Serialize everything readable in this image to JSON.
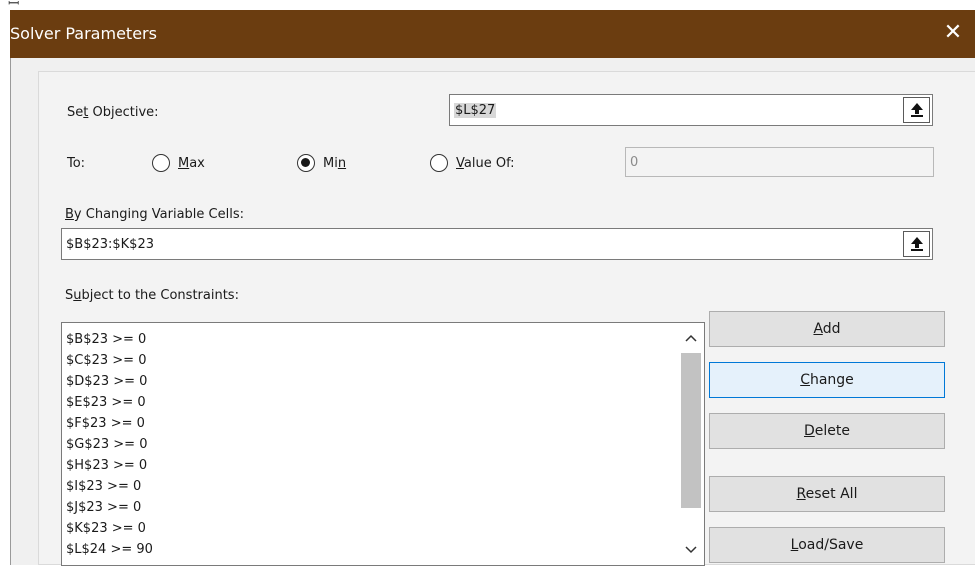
{
  "dialog": {
    "title": "Solver Parameters",
    "close_glyph": "✕"
  },
  "objective": {
    "label_pre": "Se",
    "label_u": "t",
    "label_post": " Objective:",
    "value": "$L$27"
  },
  "to": {
    "label": "To:",
    "max": {
      "pre": "",
      "u": "M",
      "post": "ax",
      "selected": false
    },
    "min": {
      "pre": "Mi",
      "u": "n",
      "post": "",
      "selected": true
    },
    "valueof": {
      "pre": "",
      "u": "V",
      "post": "alue Of:",
      "selected": false
    },
    "value_field": "0"
  },
  "changing": {
    "label_u": "B",
    "label_post": "y Changing Variable Cells:",
    "value": "$B$23:$K$23"
  },
  "constraints": {
    "label_pre": "S",
    "label_u": "u",
    "label_post": "bject to the Constraints:",
    "items": [
      "$B$23 >= 0",
      "$C$23 >= 0",
      "$D$23 >= 0",
      "$E$23 >= 0",
      "$F$23 >= 0",
      "$G$23 >= 0",
      "$H$23 >= 0",
      "$I$23 >= 0",
      "$J$23 >= 0",
      "$K$23 >= 0",
      "$L$24 >= 90"
    ]
  },
  "buttons": {
    "add": {
      "u": "A",
      "post": "dd"
    },
    "change": {
      "u": "C",
      "post": "hange"
    },
    "delete": {
      "u": "D",
      "post": "elete"
    },
    "reset": {
      "u": "R",
      "post": "eset All"
    },
    "loadsave": {
      "u": "L",
      "post": "oad/Save"
    }
  },
  "colors": {
    "titlebar": "#6b3d10",
    "focus_border": "#0078d7"
  }
}
